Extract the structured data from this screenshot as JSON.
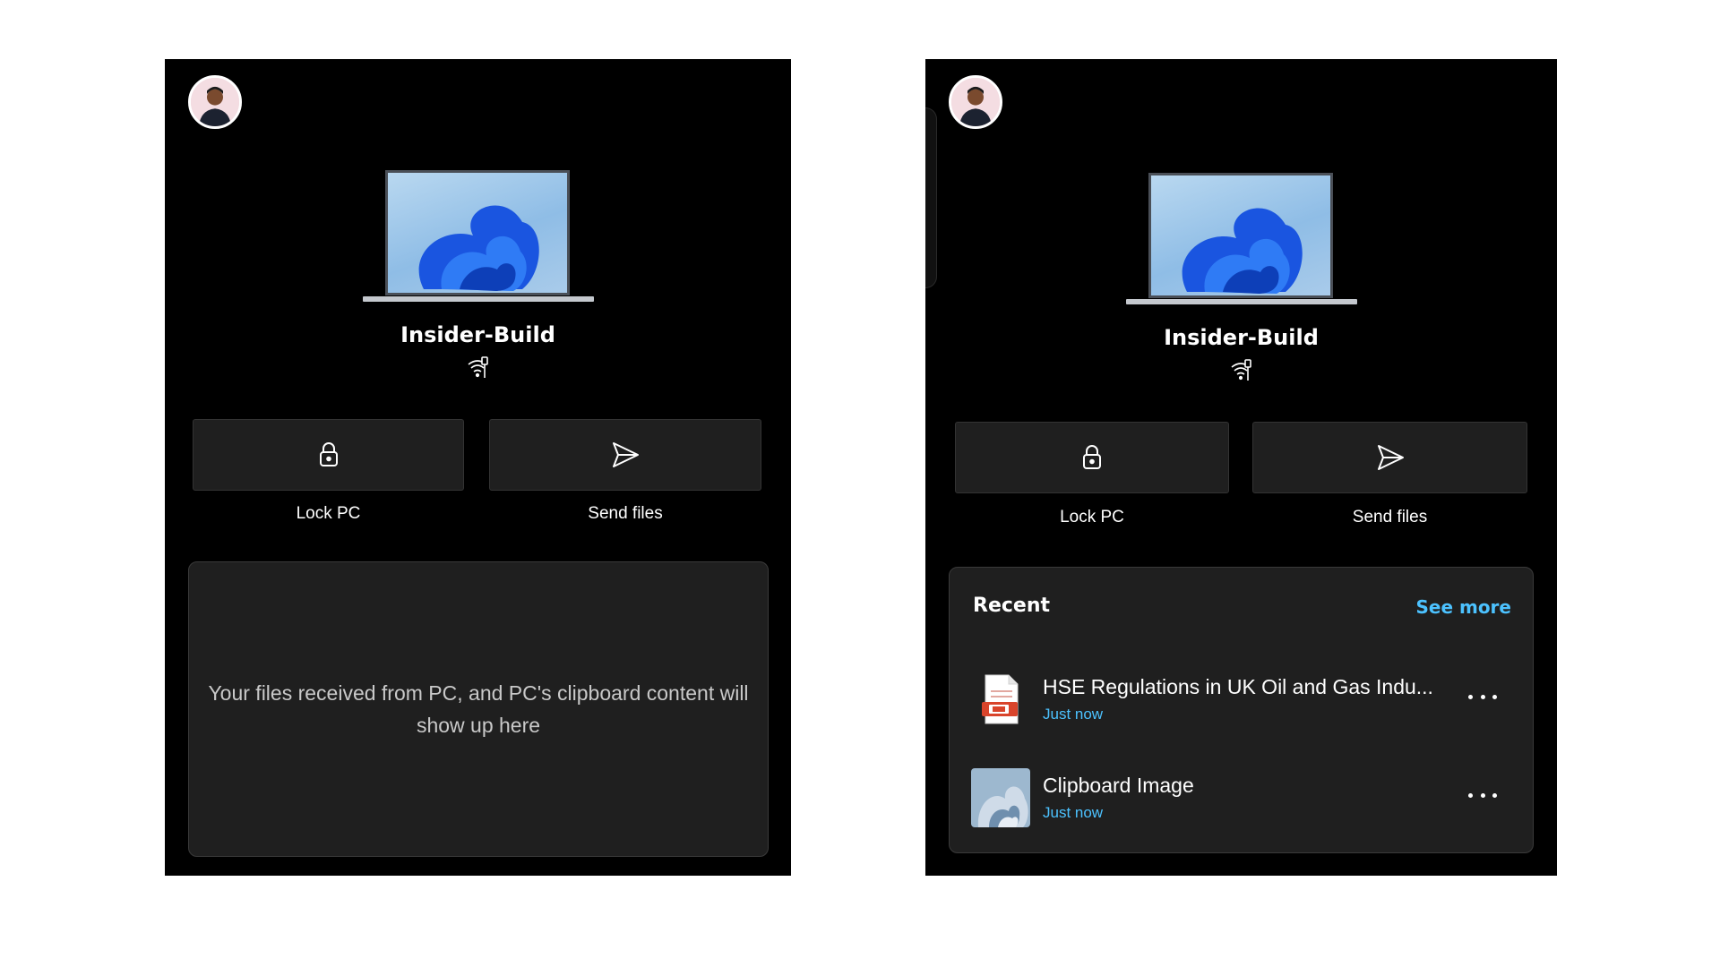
{
  "left_panel": {
    "device": {
      "name": "Insider-Build"
    },
    "actions": [
      {
        "label": "Lock PC",
        "icon": "lock-icon"
      },
      {
        "label": "Send files",
        "icon": "send-icon"
      }
    ],
    "empty_state": {
      "message": "Your files received from PC, and PC's clipboard content will show up here"
    }
  },
  "right_panel": {
    "device": {
      "name": "Insider-Build"
    },
    "actions": [
      {
        "label": "Lock PC",
        "icon": "lock-icon"
      },
      {
        "label": "Send files",
        "icon": "send-icon"
      }
    ],
    "recent": {
      "title": "Recent",
      "see_more": "See more",
      "items": [
        {
          "name": "HSE Regulations in UK Oil and Gas Indu...",
          "time": "Just now",
          "icon": "powerpoint-file-icon"
        },
        {
          "name": "Clipboard Image",
          "time": "Just now",
          "icon": "image-thumbnail"
        }
      ]
    }
  },
  "colors": {
    "panel_bg": "#000000",
    "card_bg": "#1f1f1f",
    "accent": "#4cc2ff",
    "page_bg": "#ffffff"
  }
}
